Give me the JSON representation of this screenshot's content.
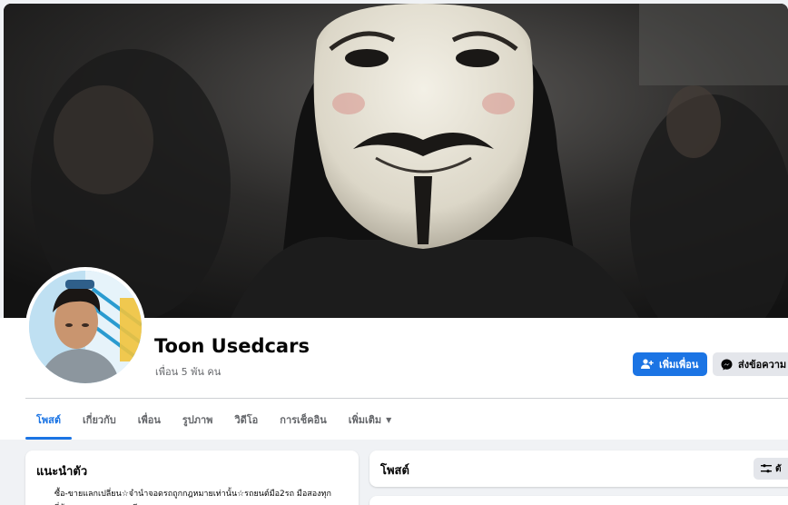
{
  "profile": {
    "name": "Toon Usedcars",
    "friends_count": "เพื่อน 5 พัน คน"
  },
  "actions": {
    "add_friend": "เพิ่มเพื่อน",
    "message": "ส่งข้อความ"
  },
  "tabs": [
    {
      "label": "โพสต์",
      "active": true
    },
    {
      "label": "เกี่ยวกับ",
      "active": false
    },
    {
      "label": "เพื่อน",
      "active": false
    },
    {
      "label": "รูปภาพ",
      "active": false
    },
    {
      "label": "วิดีโอ",
      "active": false
    },
    {
      "label": "การเช็คอิน",
      "active": false
    },
    {
      "label": "เพิ่มเติม",
      "active": false
    }
  ],
  "intro": {
    "title": "แนะนำตัว",
    "bio": "ซื้อ-ขายแลกเปลี่ยน☆จำนำจอดรถถูกกฎหมายเท่านั้น☆รถยนต์มือ2รถ มือสองทุกยี่ห้อ ราคาถูก คุณภาพดี"
  },
  "posts": {
    "title": "โพสต์",
    "filter_label": "ตั"
  },
  "colors": {
    "accent": "#1b74e4",
    "background": "#f0f2f5",
    "secondary_button": "#e4e6eb"
  },
  "icons": {
    "add_friend": "person-plus-icon",
    "message": "messenger-icon",
    "filter": "filter-icon",
    "more": "caret-down-icon"
  }
}
